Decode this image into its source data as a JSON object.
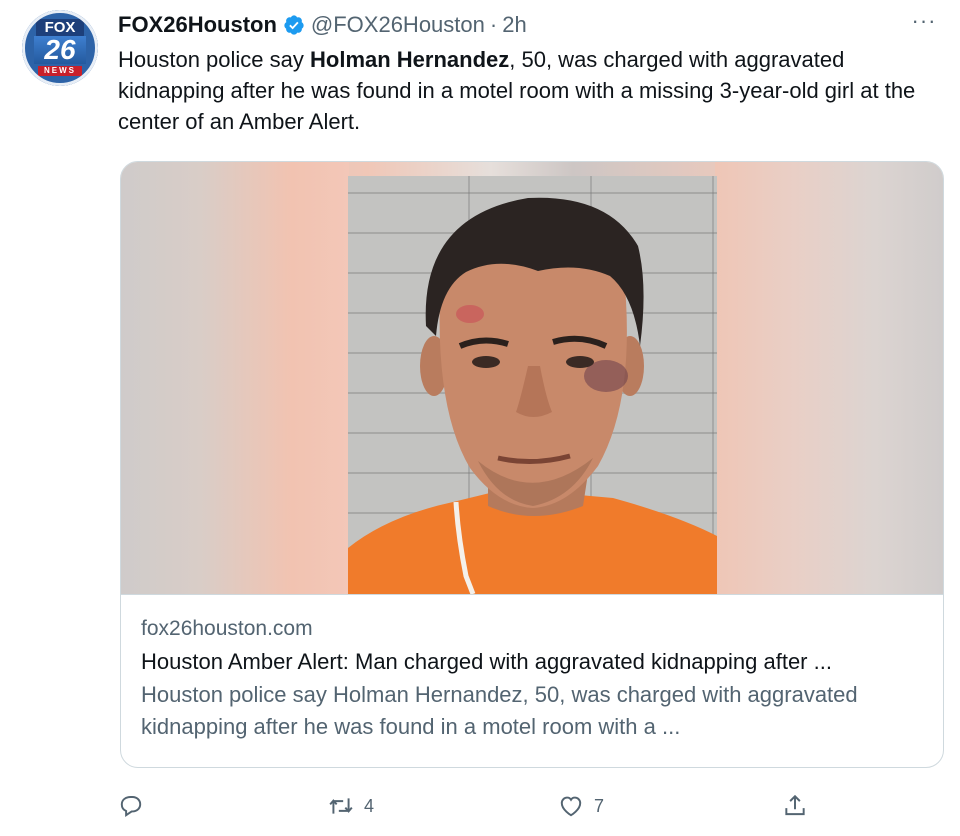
{
  "account": {
    "display_name": "FOX26Houston",
    "handle": "@FOX26Houston",
    "separator": "·",
    "timestamp": "2h",
    "avatar_logo": {
      "top": "FOX",
      "number": "26",
      "bottom": "NEWS"
    }
  },
  "tweet": {
    "text_before": "Houston police say ",
    "text_bold": "Holman Hernandez",
    "text_after": ", 50, was charged with aggravated kidnapping after he was found in a motel room with a missing 3-year-old girl at the center of an Amber Alert."
  },
  "link_card": {
    "domain": "fox26houston.com",
    "title": "Houston Amber Alert: Man charged with aggravated kidnapping after ...",
    "description": "Houston police say Holman Hernandez, 50, was charged with aggravated kidnapping after he was found in a motel room with a ..."
  },
  "actions": {
    "reply_count": "",
    "retweet_count": "4",
    "like_count": "7",
    "share_count": ""
  },
  "icons": {
    "verified": "verified-badge-icon",
    "more": "more-options-icon",
    "reply": "reply-icon",
    "retweet": "retweet-icon",
    "like": "heart-icon",
    "share": "share-icon"
  },
  "colors": {
    "text": "#0f1419",
    "secondary": "#536471",
    "verified": "#1d9bf0",
    "border": "#cfd9de",
    "jumpsuit": "#f07b2b"
  }
}
